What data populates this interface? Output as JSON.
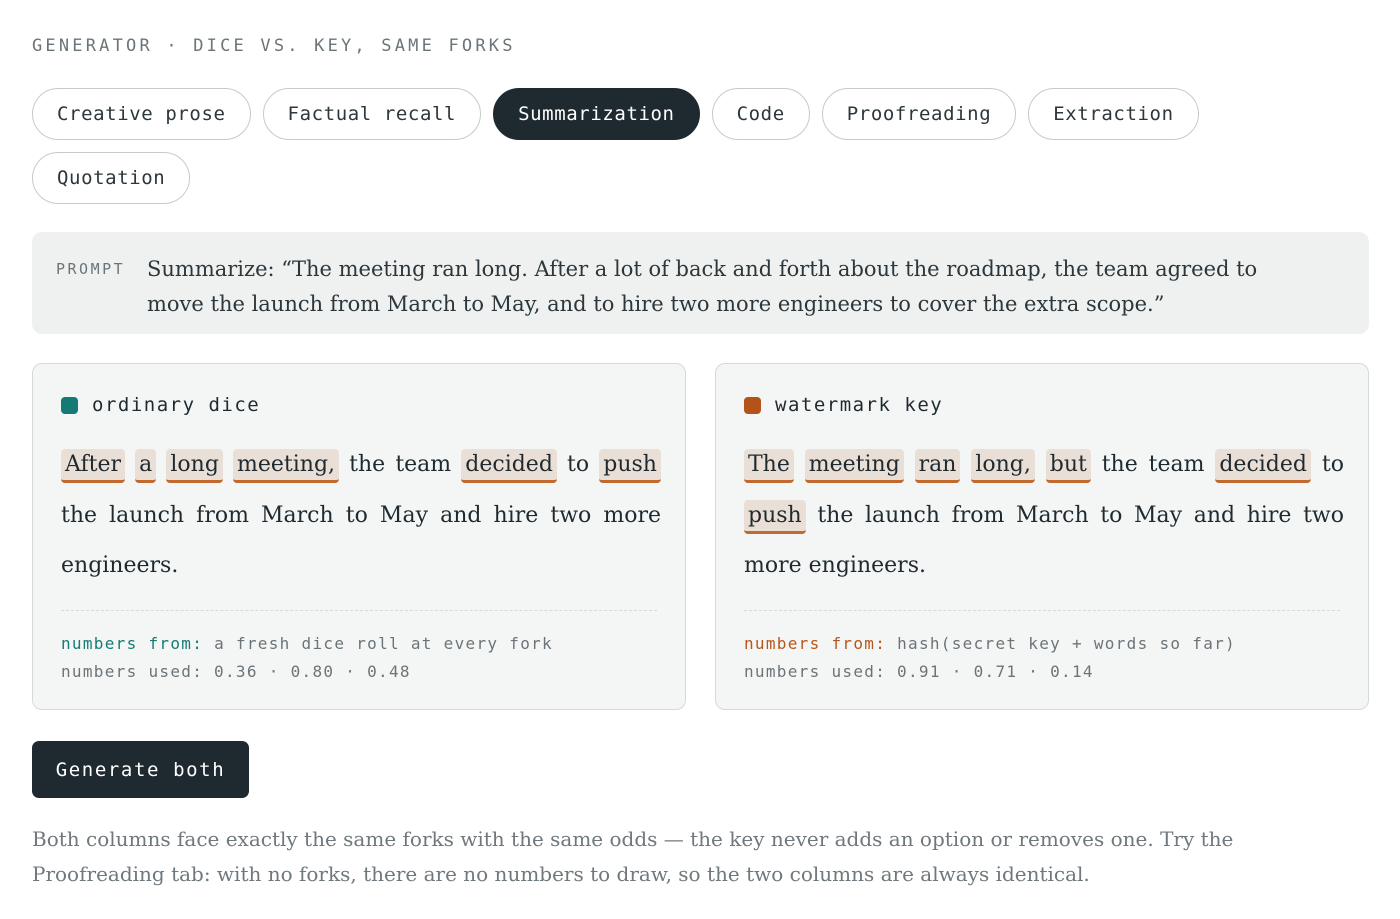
{
  "eyebrow": "GENERATOR · DICE VS. KEY, SAME FORKS",
  "tabs": [
    {
      "label": "Creative prose",
      "active": false
    },
    {
      "label": "Factual recall",
      "active": false
    },
    {
      "label": "Summarization",
      "active": true
    },
    {
      "label": "Code",
      "active": false
    },
    {
      "label": "Proofreading",
      "active": false
    },
    {
      "label": "Extraction",
      "active": false
    },
    {
      "label": "Quotation",
      "active": false
    }
  ],
  "prompt": {
    "label": "PROMPT",
    "text": "Summarize: “The meeting ran long. After a lot of back and forth about the roadmap, the team agreed to move the launch from March to May, and to hire two more engineers to cover the extra scope.”"
  },
  "panels": {
    "dice": {
      "title": "ordinary dice",
      "swatch_color": "#147a73",
      "words": [
        {
          "text": "After",
          "fork": true
        },
        {
          "text": "a",
          "fork": true
        },
        {
          "text": "long",
          "fork": true
        },
        {
          "text": "meeting,",
          "fork": true
        },
        {
          "text": "the",
          "fork": false
        },
        {
          "text": "team",
          "fork": false
        },
        {
          "text": "decided",
          "fork": true
        },
        {
          "text": "to",
          "fork": false
        },
        {
          "text": "push",
          "fork": true
        },
        {
          "text": "the",
          "fork": false
        },
        {
          "text": "launch",
          "fork": false
        },
        {
          "text": "from",
          "fork": false
        },
        {
          "text": "March",
          "fork": false
        },
        {
          "text": "to",
          "fork": false
        },
        {
          "text": "May",
          "fork": false
        },
        {
          "text": "and",
          "fork": false
        },
        {
          "text": "hire",
          "fork": false
        },
        {
          "text": "two",
          "fork": false
        },
        {
          "text": "more",
          "fork": false
        },
        {
          "text": "engineers.",
          "fork": false
        }
      ],
      "numbers_from_label": "numbers from:",
      "numbers_from_value": "a fresh dice roll at every fork",
      "numbers_used": "numbers used: 0.36 · 0.80 · 0.48"
    },
    "watermark": {
      "title": "watermark key",
      "swatch_color": "#b5521a",
      "words": [
        {
          "text": "The",
          "fork": true
        },
        {
          "text": "meeting",
          "fork": true
        },
        {
          "text": "ran",
          "fork": true
        },
        {
          "text": "long,",
          "fork": true
        },
        {
          "text": "but",
          "fork": true
        },
        {
          "text": "the",
          "fork": false
        },
        {
          "text": "team",
          "fork": false
        },
        {
          "text": "decided",
          "fork": true
        },
        {
          "text": "to",
          "fork": false
        },
        {
          "text": "push",
          "fork": true
        },
        {
          "text": "the",
          "fork": false
        },
        {
          "text": "launch",
          "fork": false
        },
        {
          "text": "from",
          "fork": false
        },
        {
          "text": "March",
          "fork": false
        },
        {
          "text": "to",
          "fork": false
        },
        {
          "text": "May",
          "fork": false
        },
        {
          "text": "and",
          "fork": false
        },
        {
          "text": "hire",
          "fork": false
        },
        {
          "text": "two",
          "fork": false
        },
        {
          "text": "more",
          "fork": false
        },
        {
          "text": "engineers.",
          "fork": false
        }
      ],
      "numbers_from_label": "numbers from:",
      "numbers_from_value": "hash(secret key + words so far)",
      "numbers_used": "numbers used: 0.91 · 0.71 · 0.14"
    }
  },
  "generate_label": "Generate both",
  "note": "Both columns face exactly the same forks with the same odds — the key never adds an option or removes one. Try the Proofreading tab: with no forks, there are no numbers to draw, so the two columns are always identical.",
  "colors": {
    "fork_highlight": "#eadfd6",
    "fork_underline": "#c1692e",
    "dark": "#1f2a30"
  }
}
